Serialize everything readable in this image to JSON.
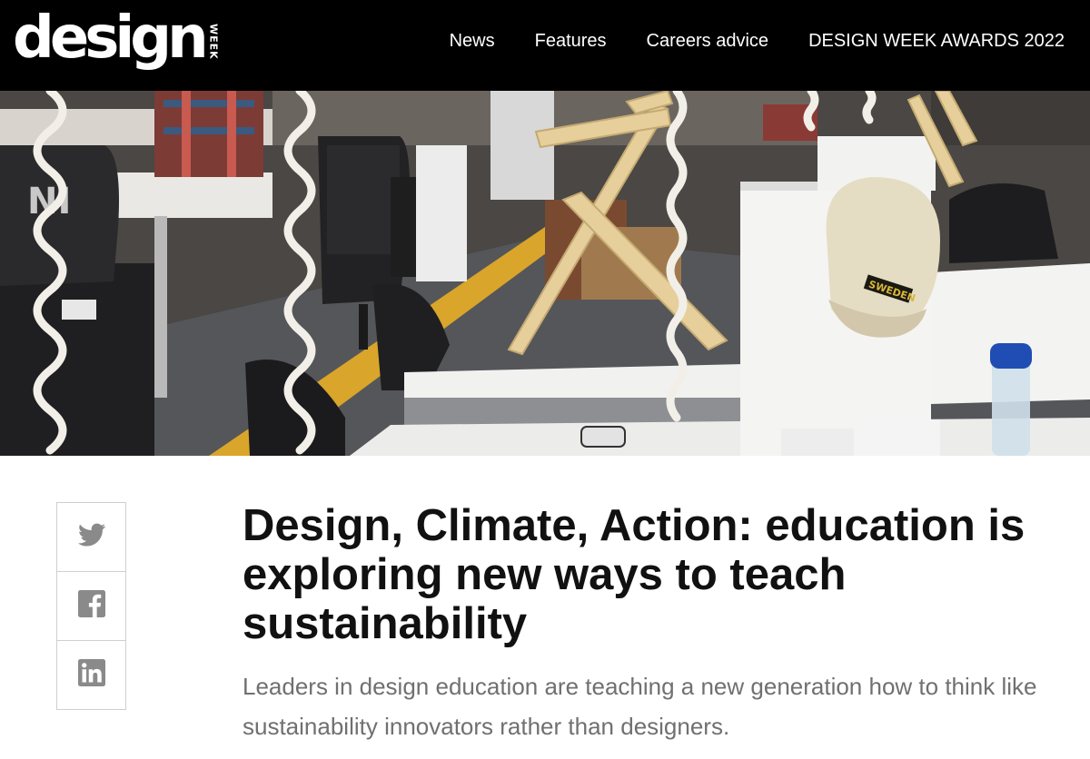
{
  "header": {
    "logo_text": "design",
    "logo_sub": "WEEK",
    "nav": [
      "News",
      "Features",
      "Careers advice",
      "DESIGN WEEK AWARDS 2022"
    ]
  },
  "hero": {
    "cap_text": "SWEDEN"
  },
  "share": {
    "icons": [
      "twitter-icon",
      "facebook-icon",
      "linkedin-icon"
    ]
  },
  "article": {
    "headline": "Design, Climate, Action: education is exploring new ways to teach sustainability",
    "standfirst": "Leaders in design education are teaching a new generation how to think like sustainability innovators rather than designers."
  },
  "colors": {
    "header_bg": "#000000",
    "headline": "#111111",
    "standfirst": "#707070",
    "share_icon": "#8a8a8a",
    "share_border": "#cfcfcf"
  }
}
